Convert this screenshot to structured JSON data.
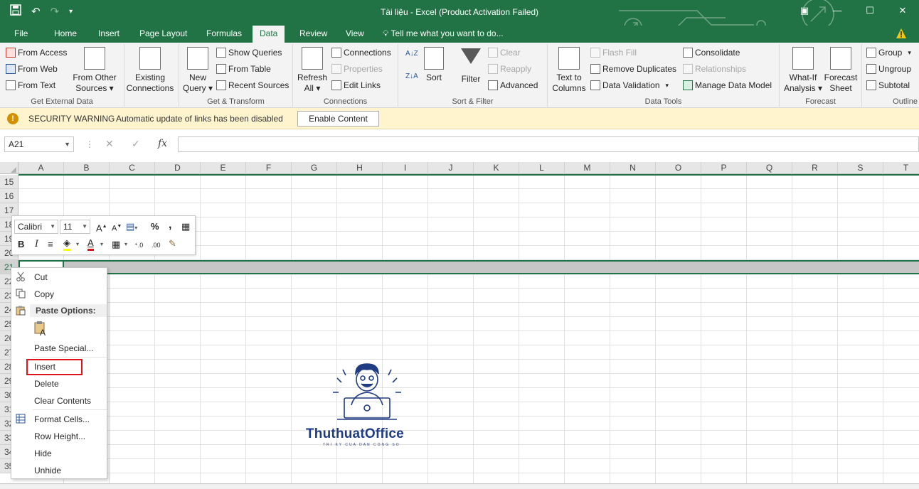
{
  "titlebar": {
    "title": "Tài liệu - Excel (Product Activation Failed)",
    "save_icon": "save-icon",
    "undo_icon": "undo-icon",
    "redo_icon": "redo-icon"
  },
  "tabs": [
    "File",
    "Home",
    "Insert",
    "Page Layout",
    "Formulas",
    "Data",
    "Review",
    "View"
  ],
  "active_tab": "Data",
  "tell_me": "Tell me what you want to do...",
  "ribbon": {
    "get_external": {
      "from_access": "From Access",
      "from_web": "From Web",
      "from_text": "From Text",
      "from_other_1": "From Other",
      "from_other_2": "Sources",
      "existing_1": "Existing",
      "existing_2": "Connections",
      "label": "Get External Data"
    },
    "get_transform": {
      "new_query_1": "New",
      "new_query_2": "Query",
      "show_queries": "Show Queries",
      "from_table": "From Table",
      "recent_sources": "Recent Sources",
      "label": "Get & Transform"
    },
    "connections": {
      "refresh_1": "Refresh",
      "refresh_2": "All",
      "connections": "Connections",
      "properties": "Properties",
      "edit_links": "Edit Links",
      "label": "Connections"
    },
    "sort_filter": {
      "sort": "Sort",
      "filter": "Filter",
      "clear": "Clear",
      "reapply": "Reapply",
      "advanced": "Advanced",
      "label": "Sort & Filter"
    },
    "data_tools": {
      "text_to_1": "Text to",
      "text_to_2": "Columns",
      "flash_fill": "Flash Fill",
      "remove_duplicates": "Remove Duplicates",
      "data_validation": "Data Validation",
      "consolidate": "Consolidate",
      "relationships": "Relationships",
      "manage_model": "Manage Data Model",
      "label": "Data Tools"
    },
    "forecast": {
      "whatif_1": "What-If",
      "whatif_2": "Analysis",
      "forecast_1": "Forecast",
      "forecast_2": "Sheet",
      "label": "Forecast"
    },
    "outline": {
      "group": "Group",
      "ungroup": "Ungroup",
      "subtotal": "Subtotal",
      "label": "Outline"
    }
  },
  "security": {
    "title": "SECURITY WARNING",
    "message": "Automatic update of links has been disabled",
    "button": "Enable Content"
  },
  "formula_bar": {
    "name_box": "A21",
    "fx": "fx",
    "cancel": "✕",
    "enter": "✓"
  },
  "columns": [
    "A",
    "B",
    "C",
    "D",
    "E",
    "F",
    "G",
    "H",
    "I",
    "J",
    "K",
    "L",
    "M",
    "N",
    "O",
    "P",
    "Q",
    "R",
    "S",
    "T"
  ],
  "rows": [
    "15",
    "16",
    "17",
    "18",
    "19",
    "20",
    "21",
    "22",
    "23",
    "24",
    "25",
    "26",
    "27",
    "28",
    "29",
    "30",
    "31",
    "32",
    "33",
    "34",
    "35"
  ],
  "selected_row": "21",
  "mini_toolbar": {
    "font": "Calibri",
    "size": "11",
    "bold": "B",
    "italic": "I",
    "percent": "%",
    "comma": ","
  },
  "context_menu": {
    "cut": "Cut",
    "copy": "Copy",
    "paste_options": "Paste Options:",
    "paste_special": "Paste Special...",
    "insert": "Insert",
    "delete": "Delete",
    "clear_contents": "Clear Contents",
    "format_cells": "Format Cells...",
    "row_height": "Row Height...",
    "hide": "Hide",
    "unhide": "Unhide"
  },
  "watermark": {
    "brand": "ThuthuatOffice",
    "tagline": "TRI KY CUA DAN CONG SO"
  },
  "colors": {
    "excel_green": "#217346",
    "highlight_red": "#e0131a",
    "warning_yellow": "#fff4ce"
  }
}
